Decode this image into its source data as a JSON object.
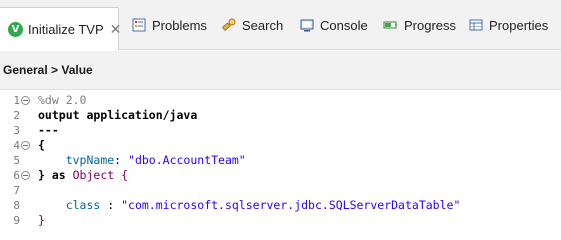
{
  "tabs": [
    {
      "label": "Initialize TVP",
      "icon": "v-badge-icon",
      "active": true,
      "closable": true
    },
    {
      "label": "Problems",
      "icon": "problems-icon"
    },
    {
      "label": "Search",
      "icon": "search-icon"
    },
    {
      "label": "Console",
      "icon": "console-icon"
    },
    {
      "label": "Progress",
      "icon": "progress-icon"
    },
    {
      "label": "Properties",
      "icon": "properties-icon"
    }
  ],
  "section": {
    "title": "General > Value"
  },
  "editor": {
    "lines": [
      {
        "num": "1",
        "fold": true,
        "text": "%dw 2.0"
      },
      {
        "num": "2",
        "fold": false,
        "text": "output application/java"
      },
      {
        "num": "3",
        "fold": false,
        "text": "---"
      },
      {
        "num": "4",
        "fold": true,
        "text": "{"
      },
      {
        "num": "5",
        "fold": false,
        "key": "tvpName",
        "value": "\"dbo.AccountTeam\""
      },
      {
        "num": "6",
        "fold": true,
        "text_a": "} as ",
        "text_b": "Object",
        "text_c": " {"
      },
      {
        "num": "7",
        "fold": false,
        "text": ""
      },
      {
        "num": "8",
        "fold": false,
        "key": "class",
        "sep": " : ",
        "value": "\"com.microsoft.sqlserver.jdbc.SQLServerDataTable\""
      },
      {
        "num": "9",
        "fold": false,
        "text": "}"
      }
    ]
  }
}
